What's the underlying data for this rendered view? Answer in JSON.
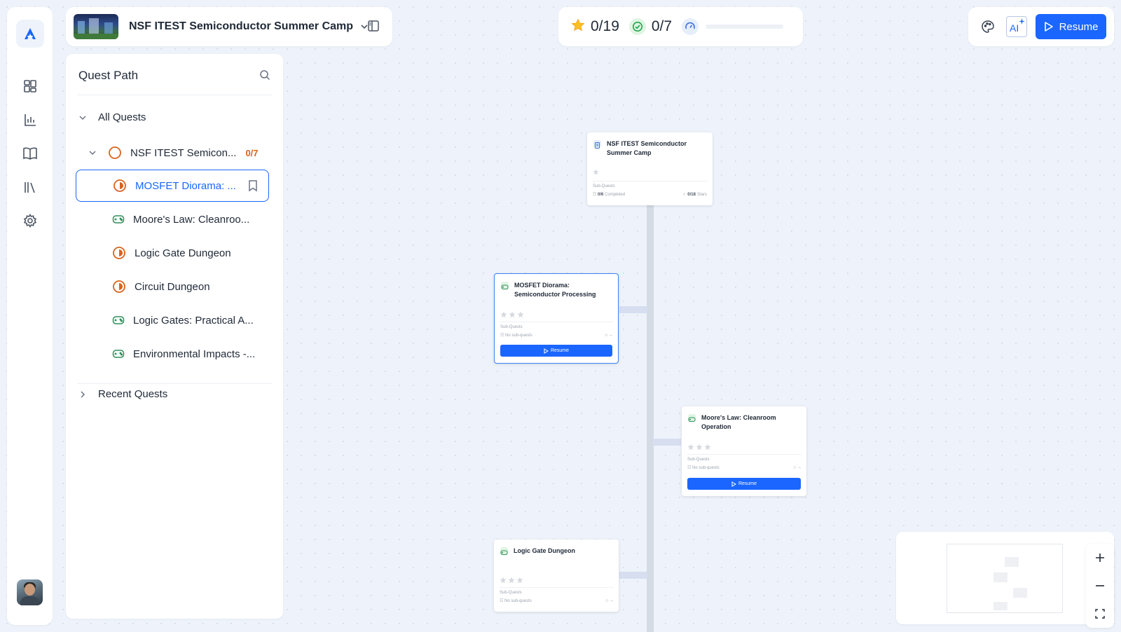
{
  "header": {
    "course_title": "NSF ITEST Semiconductor Summer Camp"
  },
  "progress": {
    "stars": "0/19",
    "completed": "0/7",
    "fraction": 0
  },
  "actions": {
    "ai_label": "AI",
    "resume_label": "Resume"
  },
  "sidebar": {
    "title": "Quest Path",
    "all_quests_label": "All Quests",
    "parent": {
      "label": "NSF ITEST Semicon...",
      "count": "0/7"
    },
    "items": [
      {
        "label": "MOSFET Diorama: ...",
        "icon": "half-circle-icon",
        "active": true
      },
      {
        "label": "Moore's Law: Cleanroo...",
        "icon": "gamepad-icon"
      },
      {
        "label": "Logic Gate Dungeon",
        "icon": "half-circle-icon"
      },
      {
        "label": "Circuit Dungeon",
        "icon": "half-circle-icon"
      },
      {
        "label": "Logic Gates: Practical A...",
        "icon": "gamepad-icon"
      },
      {
        "label": "Environmental Impacts -...",
        "icon": "gamepad-icon"
      }
    ],
    "recent_label": "Recent Quests"
  },
  "canvas": {
    "root_card": {
      "title": "NSF ITEST Semiconductor Summer Camp",
      "subquests_label": "Sub-Quests",
      "completed_value": "0/6",
      "completed_label": "Completed",
      "stars_value": "0/18",
      "stars_label": "Stars"
    },
    "cards": [
      {
        "title": "MOSFET Diorama: Semiconductor Processing",
        "subquests_label": "Sub-Quests",
        "no_sub": "No sub-quests",
        "stars_text": "--",
        "button": "Resume"
      },
      {
        "title": "Moore's Law: Cleanroom Operation",
        "subquests_label": "Sub-Quests",
        "no_sub": "No sub-quests",
        "stars_text": "--",
        "button": "Resume"
      },
      {
        "title": "Logic Gate Dungeon",
        "subquests_label": "Sub-Quests",
        "no_sub": "No sub-quests",
        "stars_text": "--"
      }
    ]
  },
  "colors": {
    "accent": "#1a66ff",
    "orange": "#d9631e",
    "green": "#2f8f5b",
    "background": "#eef3fb"
  }
}
